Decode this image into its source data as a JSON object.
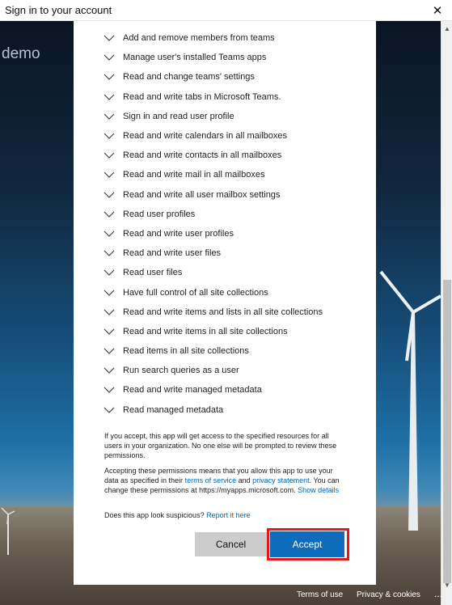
{
  "window": {
    "title": "Sign in to your account",
    "close_glyph": "✕"
  },
  "background": {
    "org_name": "demo"
  },
  "permissions": [
    "Add and remove members from teams",
    "Manage user's installed Teams apps",
    "Read and change teams' settings",
    "Read and write tabs in Microsoft Teams.",
    "Sign in and read user profile",
    "Read and write calendars in all mailboxes",
    "Read and write contacts in all mailboxes",
    "Read and write mail in all mailboxes",
    "Read and write all user mailbox settings",
    "Read user profiles",
    "Read and write user profiles",
    "Read and write user files",
    "Read user files",
    "Have full control of all site collections",
    "Read and write items and lists in all site collections",
    "Read and write items in all site collections",
    "Read items in all site collections",
    "Run search queries as a user",
    "Read and write managed metadata",
    "Read managed metadata"
  ],
  "notice": {
    "consent_text": "If you accept, this app will get access to the specified resources for all users in your organization. No one else will be prompted to review these permissions.",
    "accept_prefix": "Accepting these permissions means that you allow this app to use your data as specified in their ",
    "terms_link": "terms of service",
    "and_text": " and ",
    "privacy_link": "privacy statement",
    "change_text": ". You can change these permissions at https://myapps.microsoft.com. ",
    "details_link": "Show details",
    "suspicious_text": "Does this app look suspicious? ",
    "report_link": "Report it here"
  },
  "buttons": {
    "cancel": "Cancel",
    "accept": "Accept"
  },
  "footer": {
    "terms": "Terms of use",
    "privacy": "Privacy & cookies",
    "more": "..."
  },
  "colors": {
    "accent": "#0f6cbd",
    "highlight": "#e8171a",
    "link": "#0067b8"
  }
}
